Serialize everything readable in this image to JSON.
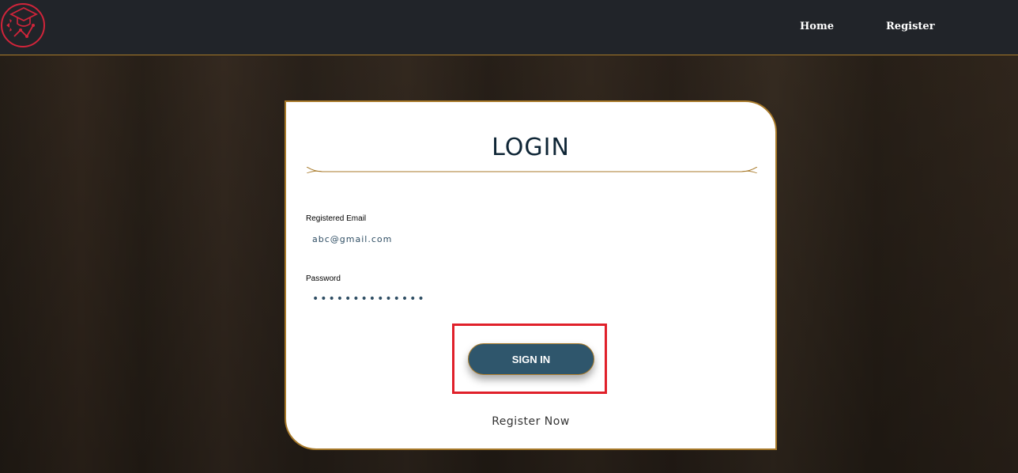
{
  "nav": {
    "home_label": "Home",
    "register_label": "Register"
  },
  "login": {
    "title": "LOGIN",
    "email_label": "Registered Email",
    "email_value": "abc@gmail.com",
    "password_label": "Password",
    "password_value": "••••••••••••••",
    "signin_label": "SIGN IN",
    "register_now_label": "Register Now"
  },
  "colors": {
    "navbar_bg": "#212429",
    "accent_gold": "#a87a2a",
    "button_bg": "#2f566c",
    "highlight_red": "#e0202a",
    "title_color": "#0f2636"
  },
  "icons": {
    "logo": "graduation-gear-logo-icon"
  }
}
